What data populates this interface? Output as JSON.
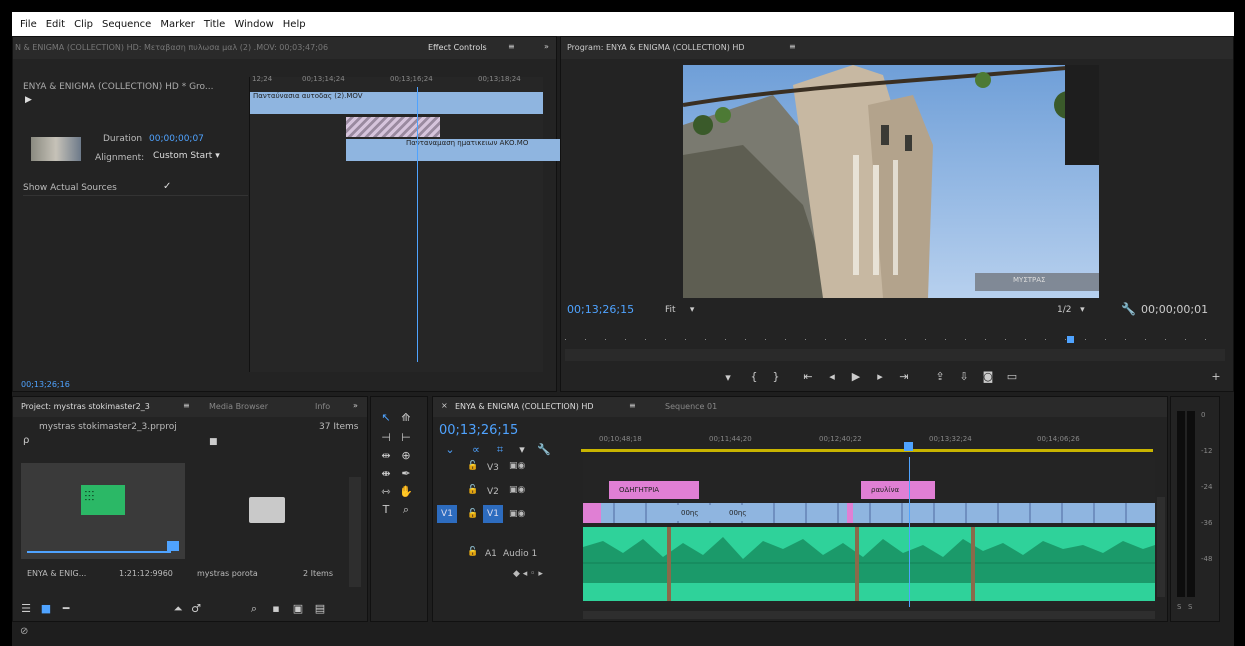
{
  "menu": [
    "File",
    "Edit",
    "Clip",
    "Sequence",
    "Marker",
    "Title",
    "Window",
    "Help"
  ],
  "source_tab": {
    "title": "N & ENIGMA (COLLECTION) HD: Μεταβαση πυλωσα μαλ (2) .MOV: 00;03;47;06",
    "effect_controls": "Effect Controls",
    "menu_glyph": "≡"
  },
  "effect_controls": {
    "clip_path": "ENYA & ENIGMA (COLLECTION) HD * Gro...",
    "ruler": [
      "12;24",
      "00;13;14;24",
      "00;13;16;24",
      "00;13;18;24"
    ],
    "clip_a": "Πανταύνασια αυτοδας (2).MOV",
    "clip_b": "Πανταναμαση ηματικειων ΑΚΟ.ΜΟ",
    "duration_label": "Duration",
    "duration_value": "00;00;00;07",
    "alignment_label": "Alignment:",
    "alignment_value": "Custom Start",
    "show_actual_sources": "Show Actual Sources",
    "checkmark": "✓",
    "timecode": "00;13;26;16"
  },
  "program": {
    "title": "Program: ENYA & ENIGMA (COLLECTION) HD",
    "menu_glyph": "≡",
    "timecode": "00;13;26;15",
    "fit": "Fit",
    "resolution": "1/2",
    "duration": "00;00;00;01",
    "overlay_text": "ΜΥΣΤΡΑΣ"
  },
  "project": {
    "tab": "Project: mystras stokimaster2_3",
    "tab_menu": "≡",
    "media_browser": "Media Browser",
    "info": "Info",
    "more": "»",
    "file": "mystras stokimaster2_3.prproj",
    "count": "37 Items",
    "item1_name": "ENYA & ENIG...",
    "item1_dur": "1:21:12:9960",
    "item2_name": "mystras porota",
    "item2_count": "2 Items"
  },
  "timeline": {
    "tab": "ENYA & ENIGMA (COLLECTION) HD",
    "tab_close": "≡",
    "tab2": "Sequence 01",
    "timecode": "00;13;26;15",
    "ruler": [
      "00;10;48;18",
      "00;11;44;20",
      "00;12;40;22",
      "00;13;32;24",
      "00;14;06;26"
    ],
    "tracks": {
      "v3": "V3",
      "v2": "V2",
      "v1": "V1",
      "v1_src": "V1",
      "a1": "A1",
      "a1_name": "Audio 1"
    },
    "clip_pink1": "ΟΔΗΓΗΤΡΙΑ",
    "clip_pink2": "ραυλίνα",
    "clip_blue1": "00ης",
    "clip_blue2": "00ης"
  },
  "meters": {
    "labels": [
      "0",
      "-12",
      "-24",
      "-36",
      "-48"
    ],
    "bottom": [
      "S",
      "S"
    ]
  },
  "icons": {
    "search": "search-icon",
    "wrench": "wrench-icon",
    "play": "play-icon",
    "folder": "folder-icon"
  }
}
